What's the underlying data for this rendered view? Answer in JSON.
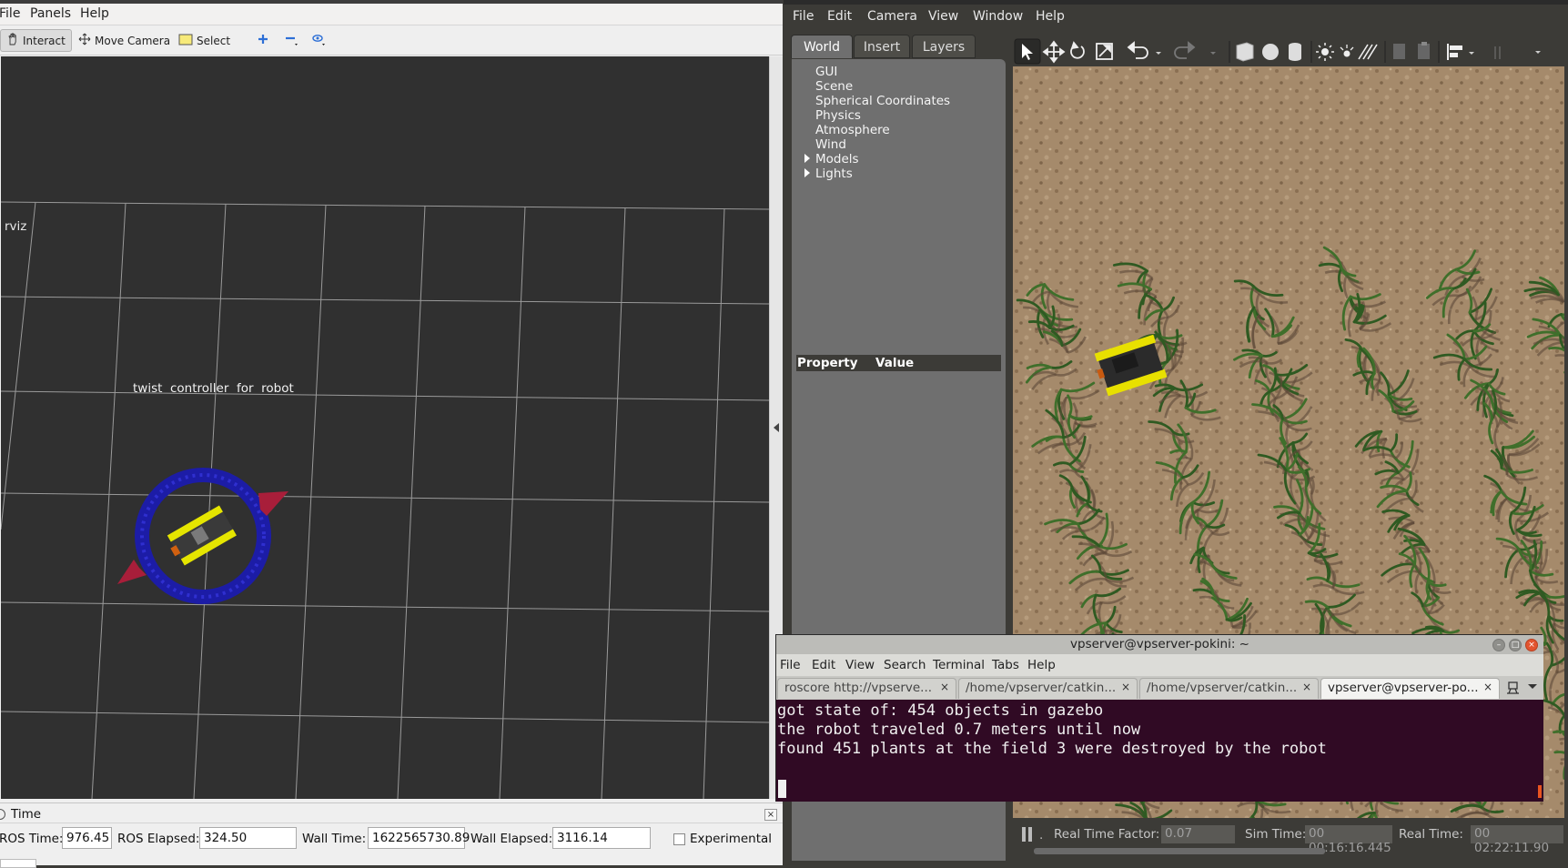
{
  "rviz": {
    "menu": [
      "File",
      "Panels",
      "Help"
    ],
    "tools": {
      "interact": "Interact",
      "move_camera": "Move Camera",
      "select": "Select"
    },
    "overlay_label": "rviz",
    "marker_text": "twist  controller  for  robot",
    "time_panel": {
      "title": "Time",
      "close": "×",
      "ros_time_label": "ROS Time:",
      "ros_time": "976.45",
      "ros_elapsed_label": "ROS Elapsed:",
      "ros_elapsed": "324.50",
      "wall_time_label": "Wall Time:",
      "wall_time": "1622565730.89",
      "wall_elapsed_label": "Wall Elapsed:",
      "wall_elapsed": "3116.14",
      "experimental_label": "Experimental"
    }
  },
  "gazebo": {
    "menu": [
      "File",
      "Edit",
      "Camera",
      "View",
      "Window",
      "Help"
    ],
    "tabs": [
      "World",
      "Insert",
      "Layers"
    ],
    "tree": [
      "GUI",
      "Scene",
      "Spherical Coordinates",
      "Physics",
      "Atmosphere",
      "Wind",
      "Models",
      "Lights"
    ],
    "property_header": {
      "property": "Property",
      "value": "Value"
    },
    "bottom": {
      "pause_icon": "pause-icon",
      "rtf_label": "Real Time Factor:",
      "rtf": "0.07",
      "sim_time_label": "Sim Time:",
      "sim_time": "00 00:16:16.445",
      "real_time_label": "Real Time:",
      "real_time": "00 02:22:11.90"
    }
  },
  "terminal": {
    "title": "vpserver@vpserver-pokini: ~",
    "menu": [
      "File",
      "Edit",
      "View",
      "Search",
      "Terminal",
      "Tabs",
      "Help"
    ],
    "tabs": [
      {
        "label": "roscore http://vpserve..."
      },
      {
        "label": "/home/vpserver/catkin..."
      },
      {
        "label": "/home/vpserver/catkin..."
      },
      {
        "label": "vpserver@vpserver-po..."
      }
    ],
    "lines": [
      "got state of: 454 objects in gazebo",
      "the robot traveled 0.7 meters until now",
      "found 451 plants at the field 3 were destroyed by the robot"
    ]
  },
  "colors": {
    "rviz_bg": "#303030",
    "grid": "#a0a0a0",
    "ring": "#1f1fa8",
    "arrow": "#b0223b",
    "robot_yellow": "#e6e600",
    "terminal_bg": "#300a24",
    "ubuntu_orange": "#e95420",
    "soil": "#a08466",
    "crop": "#3e6b2c"
  }
}
